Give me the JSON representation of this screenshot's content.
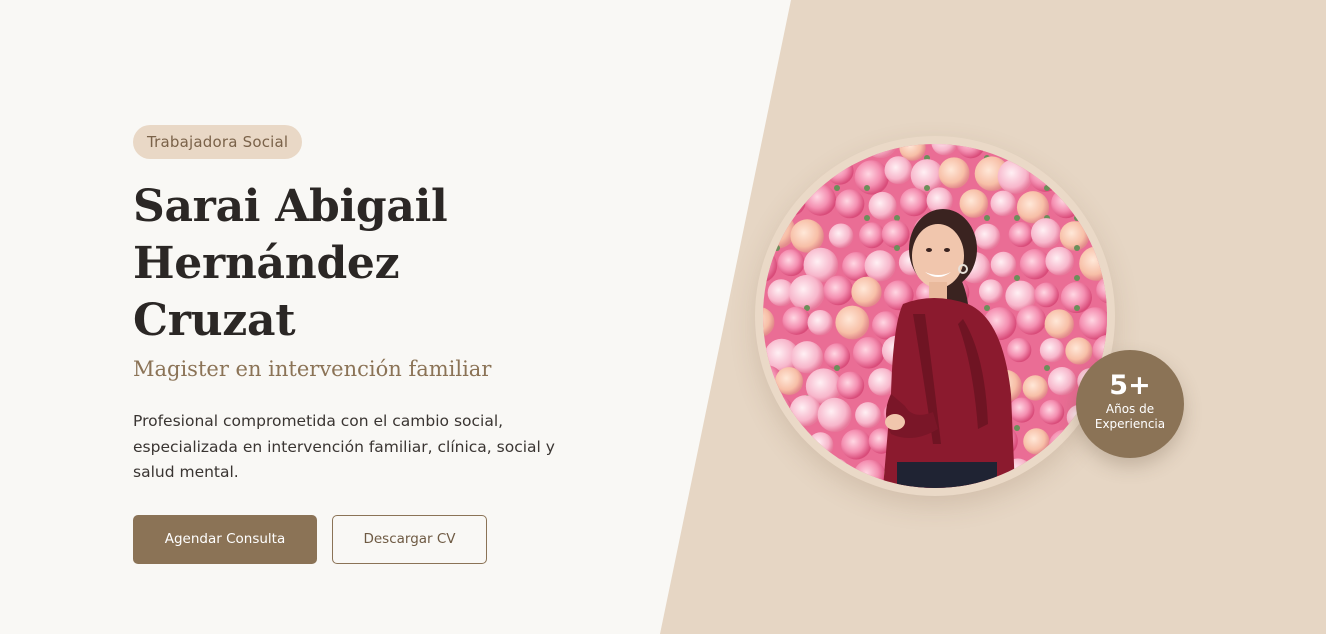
{
  "hero": {
    "badge": "Trabajadora Social",
    "name_line1": "Sarai Abigail Hernández",
    "name_line2": "Cruzat",
    "subtitle": "Magister en intervención familiar",
    "description_line1": "Profesional comprometida con el cambio social,",
    "description_line2": "especializada en intervención familiar, clínica, social y",
    "description_line3": "salud mental.",
    "primary_button": "Agendar Consulta",
    "secondary_button": "Descargar CV"
  },
  "experience": {
    "number": "5+",
    "label_line1": "Años de",
    "label_line2": "Experiencia"
  },
  "colors": {
    "accent": "#8b7356",
    "diagonal_bg": "#e6d6c4",
    "badge_bg": "#e9d8c6",
    "page_bg": "#f9f8f5",
    "text_dark": "#2b2725"
  },
  "icons": {
    "profile_photo": "portrait-photo"
  }
}
